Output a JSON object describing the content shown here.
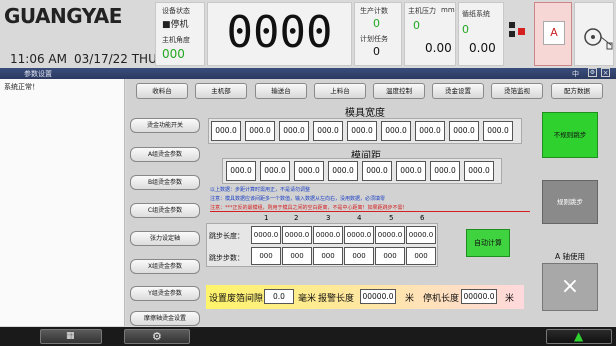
{
  "header": {
    "logo": "GUANGYAE",
    "time": "11:06 AM",
    "date": "03/17/22 THU",
    "device_status_label": "设备状态",
    "device_status_value": "■停机",
    "spindle_angle_label": "主机角度",
    "spindle_angle_value": "000",
    "main_counter": "0000",
    "production_count_label": "生产计数",
    "production_count_value": "0",
    "plan_label": "计划任务",
    "plan_value": "0",
    "main_pressure_label": "主机压力",
    "pressure_unit": "mm",
    "pressure_value": "0",
    "pressure_value2": "0.00",
    "coil_label": "循纸系统",
    "coil_value": "0",
    "coil_value2": "0.00",
    "alarm_label": "A"
  },
  "window": {
    "title": "参数设置",
    "lang": "中"
  },
  "sidebar": {
    "status": "系统正常！"
  },
  "top_buttons": [
    "收料台",
    "主机部",
    "输送台",
    "上料台",
    "温度控制",
    "烫金设置",
    "烫箔监视",
    "配方数据"
  ],
  "side_buttons": [
    "烫金功能开关",
    "A组烫金参数",
    "B组烫金参数",
    "C组烫金参数",
    "张力设定轴",
    "X组烫金参数",
    "Y组烫金参数",
    "摩擦轴烫金设置"
  ],
  "mold_width": {
    "title": "模具宽度",
    "values": [
      "000.0",
      "000.0",
      "000.0",
      "000.0",
      "000.0",
      "000.0",
      "000.0",
      "000.0",
      "000.0"
    ]
  },
  "mold_gap": {
    "title": "模间距",
    "values": [
      "000.0",
      "000.0",
      "000.0",
      "000.0",
      "000.0",
      "000.0",
      "000.0",
      "000.0"
    ]
  },
  "notes": [
    "以上数据：步距计算时需用正，不是请勿调整",
    "注意：模具数据应该间距多一个数值，输入数据从左向右，没用数据，必须填零",
    "注意：***正反的最模组，则用于模具之间的空白距离，不是中心距离！如果距跳步不需!"
  ],
  "jump_table": {
    "columns": [
      "1",
      "2",
      "3",
      "4",
      "5",
      "6"
    ],
    "length_label": "跳步长度：",
    "length_values": [
      "0000.0",
      "0000.0",
      "0000.0",
      "0000.0",
      "0000.0",
      "0000.0"
    ],
    "steps_label": "跳步步数：",
    "steps_values": [
      "000",
      "000",
      "000",
      "000",
      "000",
      "000"
    ]
  },
  "auto_calc_button": "自动计算",
  "no_jump_button": "不规则跳步",
  "regular_jump_button": "规则跳步",
  "a_axis_label": "A 轴使用",
  "bottom_settings": {
    "waste_label": "设置废箔间隙",
    "waste_value": "0.0",
    "waste_unit": "毫米",
    "alarm_len_label": "报警长度",
    "alarm_len_value": "00000.0",
    "alarm_len_unit": "米",
    "stop_len_label": "停机长度",
    "stop_len_value": "00000.0",
    "stop_len_unit": "米"
  },
  "colors": {
    "accent_green": "#2fd12f",
    "title_bar": "#2f3f68"
  }
}
